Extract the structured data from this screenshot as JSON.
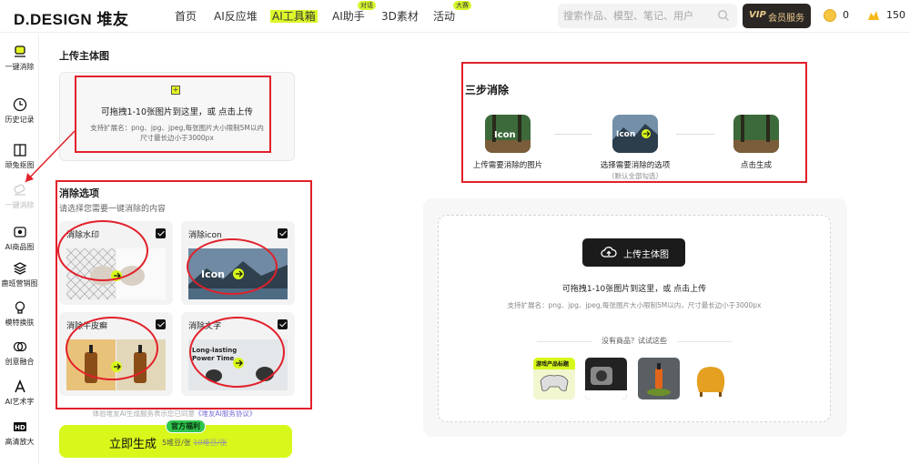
{
  "header": {
    "logo": "D.DESIGN 堆友",
    "nav": [
      {
        "label": "首页",
        "badge": ""
      },
      {
        "label": "AI反应堆",
        "badge": ""
      },
      {
        "label": "AI工具箱",
        "badge": ""
      },
      {
        "label": "AI助手",
        "badge": "对话"
      },
      {
        "label": "3D素材",
        "badge": ""
      },
      {
        "label": "活动",
        "badge": "大赛"
      }
    ],
    "search_placeholder": "搜索作品、模型、笔记、用户",
    "vip_tag": "VIP",
    "vip_label": "会员服务",
    "coin_value": "0",
    "bean_value": "150"
  },
  "sidebar": {
    "items": [
      {
        "label": "一键消除",
        "icon": "eraser-icon"
      },
      {
        "label": "历史记录",
        "icon": "clock-icon"
      },
      {
        "label": "顽兔抠图",
        "icon": "book-icon"
      },
      {
        "label": "一键消除",
        "icon": "eraser-icon"
      },
      {
        "label": "AI商品图",
        "icon": "image-icon"
      },
      {
        "label": "鹿班营销图",
        "icon": "layers-icon"
      },
      {
        "label": "模特换肤",
        "icon": "bulb-icon"
      },
      {
        "label": "创意融合",
        "icon": "rings-icon"
      },
      {
        "label": "AI艺术字",
        "icon": "letter-a-icon"
      },
      {
        "label": "高清放大",
        "icon": "hd-icon"
      }
    ]
  },
  "panel": {
    "upload_title": "上传主体图",
    "upload_main": "可拖拽1-10张图片到这里，或 点击上传",
    "upload_sub1": "支持扩展名：png、jpg、jpeg,每张图片大小限制5M以内",
    "upload_sub2": "尺寸最长边小于3000px",
    "options_title": "消除选项",
    "options_sub": "请选择您需要一键消除的内容",
    "options": [
      {
        "label": "消除水印",
        "checked": true
      },
      {
        "label": "消除icon",
        "checked": true
      },
      {
        "label": "消除牛皮癣",
        "checked": true
      },
      {
        "label": "消除文字",
        "checked": true
      }
    ],
    "sample_icon_text": "Icon",
    "sample_text_line1": "Long-lasting",
    "sample_text_line2": "Power Time",
    "terms_text": "体验堆友AI生成服务表示您已同意",
    "terms_link": "《堆友AI服务协议》",
    "generate_label": "立即生成",
    "price": "5堆豆/张",
    "old_price": "10堆豆/张",
    "badge": "官方福利"
  },
  "main": {
    "steps_title": "三步消除",
    "steps": [
      {
        "label": "上传需要消除的图片",
        "sub": ""
      },
      {
        "label": "选择需要消除的选项",
        "sub": "（默认全部勾选）"
      },
      {
        "label": "点击生成",
        "sub": ""
      }
    ],
    "step_icon_text": "Icon",
    "upload_button": "上传主体图",
    "upload_main": "可拖拽1-10张图片到这里，或 点击上传",
    "upload_sub": "支持扩展名：png、jpg、jpeg,每张图片大小限制5M以内，尺寸最长边小于3000px",
    "try_text": "没有商品？试试这些",
    "sample_caption": "游戏产品标题"
  },
  "colors": {
    "accent": "#d8f71b",
    "annotation": "#e2202a",
    "dark": "#1b1b1b"
  }
}
